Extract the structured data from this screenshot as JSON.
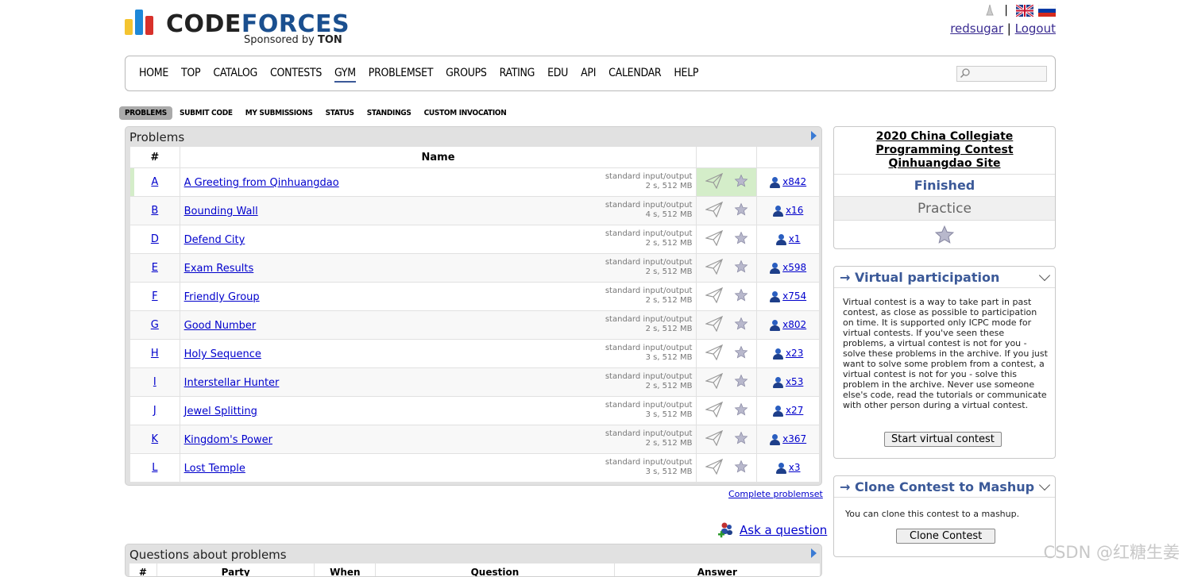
{
  "header": {
    "logo_word_a": "CODE",
    "logo_word_b": "FORCES",
    "sponsor_prefix": "Sponsored by",
    "sponsor_name": "TON",
    "username": "redsugar",
    "logout": "Logout",
    "separator": "|"
  },
  "menu": {
    "items": [
      "HOME",
      "TOP",
      "CATALOG",
      "CONTESTS",
      "GYM",
      "PROBLEMSET",
      "GROUPS",
      "RATING",
      "EDU",
      "API",
      "CALENDAR",
      "HELP"
    ],
    "active": "GYM"
  },
  "submenu": {
    "items": [
      "PROBLEMS",
      "SUBMIT CODE",
      "MY SUBMISSIONS",
      "STATUS",
      "STANDINGS",
      "CUSTOM INVOCATION"
    ],
    "active": "PROBLEMS"
  },
  "problems": {
    "title": "Problems",
    "col_index": "#",
    "col_name": "Name",
    "rows": [
      {
        "index": "A",
        "name": "A Greeting from Qinhuangdao",
        "io": "standard input/output",
        "limits": "2 s, 512 MB",
        "solved": "x842"
      },
      {
        "index": "B",
        "name": "Bounding Wall",
        "io": "standard input/output",
        "limits": "4 s, 512 MB",
        "solved": "x16"
      },
      {
        "index": "D",
        "name": "Defend City",
        "io": "standard input/output",
        "limits": "2 s, 512 MB",
        "solved": "x1"
      },
      {
        "index": "E",
        "name": "Exam Results",
        "io": "standard input/output",
        "limits": "2 s, 512 MB",
        "solved": "x598"
      },
      {
        "index": "F",
        "name": "Friendly Group",
        "io": "standard input/output",
        "limits": "2 s, 512 MB",
        "solved": "x754"
      },
      {
        "index": "G",
        "name": "Good Number",
        "io": "standard input/output",
        "limits": "2 s, 512 MB",
        "solved": "x802"
      },
      {
        "index": "H",
        "name": "Holy Sequence",
        "io": "standard input/output",
        "limits": "3 s, 512 MB",
        "solved": "x23"
      },
      {
        "index": "I",
        "name": "Interstellar Hunter",
        "io": "standard input/output",
        "limits": "2 s, 512 MB",
        "solved": "x53"
      },
      {
        "index": "J",
        "name": "Jewel Splitting",
        "io": "standard input/output",
        "limits": "3 s, 512 MB",
        "solved": "x27"
      },
      {
        "index": "K",
        "name": "Kingdom's Power",
        "io": "standard input/output",
        "limits": "2 s, 512 MB",
        "solved": "x367"
      },
      {
        "index": "L",
        "name": "Lost Temple",
        "io": "standard input/output",
        "limits": "3 s, 512 MB",
        "solved": "x3"
      }
    ],
    "complete_problemset": "Complete problemset",
    "ask_question": "Ask a question"
  },
  "questions": {
    "title": "Questions about problems",
    "col_index": "#",
    "col_party": "Party",
    "col_when": "When",
    "col_question": "Question",
    "col_answer": "Answer"
  },
  "sidebar": {
    "contest_name": "2020 China Collegiate Programming Contest Qinhuangdao Site",
    "status": "Finished",
    "mode": "Practice",
    "virtual": {
      "title": "→ Virtual participation",
      "text": "Virtual contest is a way to take part in past contest, as close as possible to participation on time. It is supported only ICPC mode for virtual contests. If you've seen these problems, a virtual contest is not for you - solve these problems in the archive. If you just want to solve some problem from a contest, a virtual contest is not for you - solve this problem in the archive. Never use someone else's code, read the tutorials or communicate with other person during a virtual contest.",
      "button": "Start virtual contest"
    },
    "clone": {
      "title": "→ Clone Contest to Mashup",
      "text": "You can clone this contest to a mashup.",
      "button": "Clone Contest"
    }
  },
  "watermark": "CSDN @红糖生姜",
  "colors": {
    "accent": "#3b5998",
    "solved_bg": "#d4edc9",
    "link": "#0000cc"
  }
}
